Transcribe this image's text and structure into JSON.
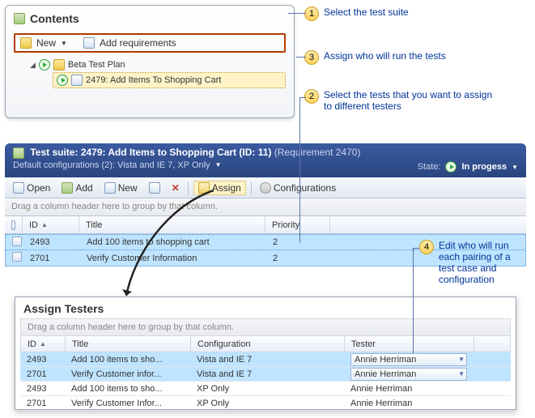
{
  "callouts": {
    "c1": "Select the test suite",
    "c2": "Select the tests that you want to assign to different testers",
    "c3": "Assign who will run the tests",
    "c4": "Edit who will run each pairing of a test case and configuration"
  },
  "contents": {
    "title": "Contents",
    "toolbar": {
      "newLabel": "New",
      "addReq": "Add requirements"
    },
    "tree": {
      "root": "Beta Test Plan",
      "child": "2479: Add Items To Shopping Cart"
    }
  },
  "suite": {
    "prefix": "Test suite:",
    "name": "2479: Add Items to Shopping Cart (ID: 11)",
    "req": "(Requirement 2470)",
    "configLine": "Default configurations (2): Vista and IE 7, XP Only",
    "stateLabel": "State:",
    "stateValue": "In progess"
  },
  "toolbar2": {
    "open": "Open",
    "add": "Add",
    "new": "New",
    "assign": "Assign",
    "configs": "Configurations"
  },
  "grid1": {
    "groupHint": "Drag a column header here to group by that column.",
    "cols": {
      "id": "ID",
      "title": "Title",
      "priority": "Priority"
    },
    "rows": [
      {
        "id": "2493",
        "title": "Add 100 items to shopping cart",
        "priority": "2"
      },
      {
        "id": "2701",
        "title": "Verify Customer Information",
        "priority": "2"
      }
    ]
  },
  "dialog": {
    "title": "Assign Testers",
    "groupHint": "Drag a column header here to group by that column.",
    "cols": {
      "id": "ID",
      "title": "Title",
      "config": "Configuration",
      "tester": "Tester"
    },
    "rows": [
      {
        "id": "2493",
        "title": "Add 100 items to sho...",
        "config": "Vista and IE 7",
        "tester": "Annie Herriman",
        "sel": true,
        "dd": true
      },
      {
        "id": "2701",
        "title": "Verify Customer infor...",
        "config": "Vista and IE 7",
        "tester": "Annie Herriman",
        "sel": true,
        "dd": true
      },
      {
        "id": "2493",
        "title": "Add 100 items to sho...",
        "config": "XP Only",
        "tester": "Annie Herriman",
        "sel": false,
        "dd": false
      },
      {
        "id": "2701",
        "title": "Verify Customer Infor...",
        "config": "XP Only",
        "tester": "Annie Herriman",
        "sel": false,
        "dd": false
      }
    ]
  }
}
